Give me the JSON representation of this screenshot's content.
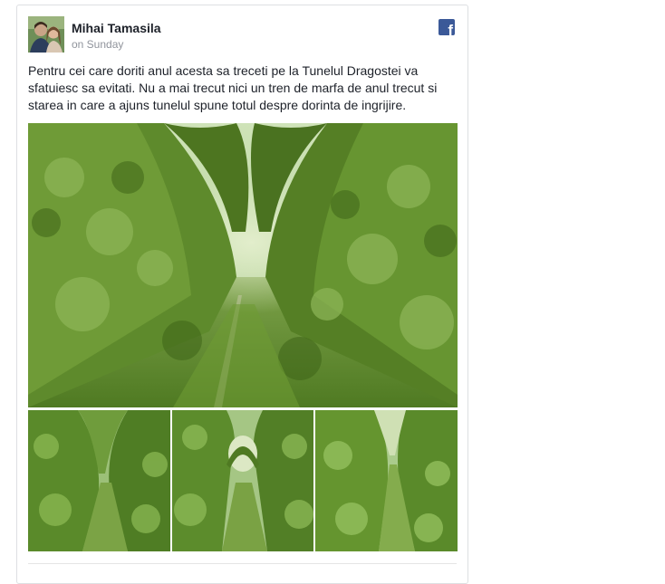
{
  "post": {
    "author": "Mihai Tamasila",
    "time": "on Sunday",
    "text": "Pentru cei care doriti anul acesta sa treceti pe la Tunelul Dragostei va sfatuiesc sa evitati. Nu a mai trecut nici un tren de marfa de anul trecut si starea in care a ajuns tunelul spune totul despre dorinta de ingrijire.",
    "platform_icon": "facebook-icon",
    "platform_icon_glyph": "f"
  },
  "photos": {
    "count_main": 1,
    "count_thumbs": 3,
    "subject": "overgrown railway tunnel of trees"
  },
  "colors": {
    "name": "#1d2129",
    "meta": "#90949c",
    "facebook_blue": "#3b5998",
    "card_border": "#dddfe2"
  }
}
